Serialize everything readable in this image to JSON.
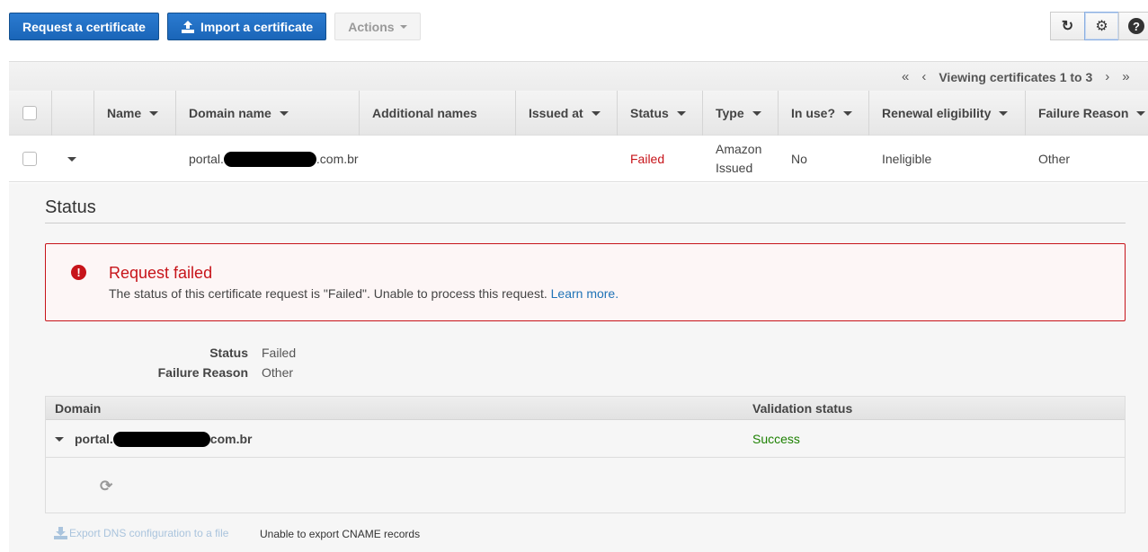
{
  "toolbar": {
    "request_label": "Request a certificate",
    "import_label": "Import a certificate",
    "actions_label": "Actions",
    "refresh_icon": "↻",
    "settings_icon": "⚙",
    "help_icon": "?"
  },
  "pager": {
    "first": "«",
    "prev": "‹",
    "text": "Viewing certificates 1 to 3",
    "next": "›",
    "last": "»"
  },
  "table": {
    "columns": [
      {
        "label": "Name",
        "sortable": true
      },
      {
        "label": "Domain name",
        "sortable": true
      },
      {
        "label": "Additional names",
        "sortable": false
      },
      {
        "label": "Issued at",
        "sortable": true
      },
      {
        "label": "Status",
        "sortable": true
      },
      {
        "label": "Type",
        "sortable": true
      },
      {
        "label": "In use?",
        "sortable": true
      },
      {
        "label": "Renewal eligibility",
        "sortable": true
      },
      {
        "label": "Failure Reason",
        "sortable": true
      }
    ],
    "rows": [
      {
        "name": "",
        "domain_prefix": "portal.",
        "domain_suffix": ".com.br",
        "additional_names": "",
        "issued_at": "",
        "status": "Failed",
        "type_line1": "Amazon",
        "type_line2": "Issued",
        "in_use": "No",
        "renewal": "Ineligible",
        "failure_reason": "Other"
      }
    ]
  },
  "detail": {
    "section_title": "Status",
    "alert": {
      "title": "Request failed",
      "message": "The status of this certificate request is \"Failed\". Unable to process this request. ",
      "link": "Learn more."
    },
    "fields": [
      {
        "label": "Status",
        "value": "Failed"
      },
      {
        "label": "Failure Reason",
        "value": "Other"
      }
    ],
    "domains_table": {
      "col_domain": "Domain",
      "col_validation": "Validation status",
      "row": {
        "domain_prefix": "portal.",
        "domain_suffix": "com.br",
        "validation": "Success"
      }
    },
    "export_link": "Export DNS configuration to a file",
    "export_note": "Unable to export CNAME records"
  },
  "colors": {
    "primary": "#1a65b8",
    "failed": "#c7141a",
    "success": "#1d8102",
    "link": "#2073b7"
  }
}
